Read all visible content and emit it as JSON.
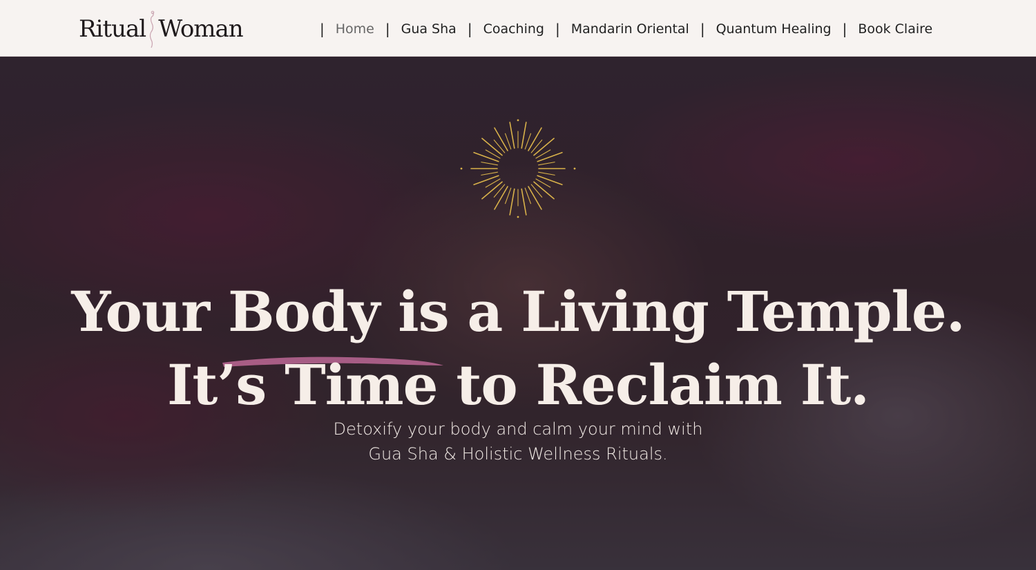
{
  "brand": {
    "logo_left": "Ritual",
    "logo_right": "Woman"
  },
  "nav": {
    "separator": "|",
    "items": [
      {
        "label": "Home",
        "active": true
      },
      {
        "label": "Gua Sha",
        "active": false
      },
      {
        "label": "Coaching",
        "active": false
      },
      {
        "label": "Mandarin Oriental",
        "active": false
      },
      {
        "label": "Quantum Healing",
        "active": false
      },
      {
        "label": "Book Claire",
        "active": false
      }
    ]
  },
  "hero": {
    "headline_line1": "Your Body is a Living Temple.",
    "headline_line2": "It’s Time to Reclaim It.",
    "subline_line1": "Detoxify your body and calm your mind with",
    "subline_line2": "Gua Sha & Holistic Wellness Rituals.",
    "sun_icon": "sunburst-icon"
  },
  "colors": {
    "header_bg": "#f7f3f1",
    "text_light": "#f6eee8",
    "accent_gold": "#d9b24a",
    "accent_brush": "#b5648f"
  }
}
